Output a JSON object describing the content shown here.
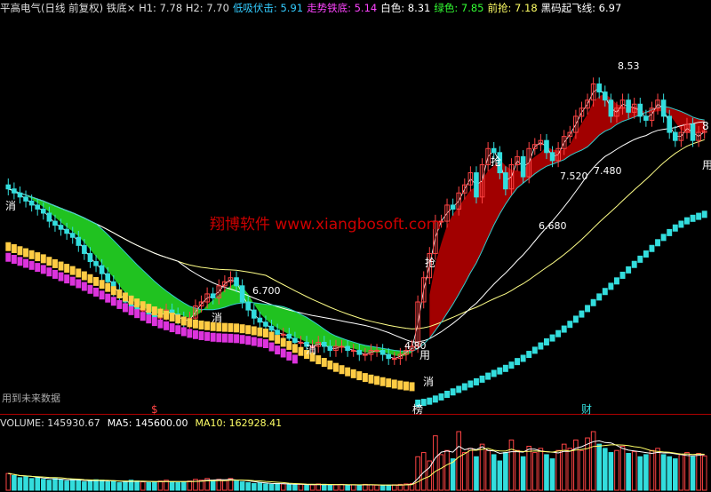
{
  "header": {
    "items": [
      {
        "text": "平高电气(日线 前复权) 铁底× H1: 7.78 H2: 7.70",
        "color": "#dddddd"
      },
      {
        "text": "低吸伏击: 5.91",
        "color": "#33ccff"
      },
      {
        "text": "走势铁底: 5.14",
        "color": "#ff44ff"
      },
      {
        "text": "白色: 8.31",
        "color": "#ffffff"
      },
      {
        "text": "绿色: 7.85",
        "color": "#33ff33"
      },
      {
        "text": "前抢: 7.18",
        "color": "#ffff66"
      },
      {
        "text": "黑码起飞线: 6.97",
        "color": "#ffffff"
      }
    ]
  },
  "watermark": "翔博软件 www.xiangbosoft.com",
  "future_note": "用到未来数据",
  "volume_header": {
    "items": [
      {
        "text": "VOLUME: 145930.67",
        "color": "#dddddd"
      },
      {
        "text": "MA5: 145600.00",
        "color": "#ffffff"
      },
      {
        "text": "MA10: 162928.41",
        "color": "#ffff66"
      }
    ]
  },
  "colors": {
    "up": "#ff4444",
    "down": "#33dddd",
    "green_band": "#22cc22",
    "red_band": "#aa0000",
    "yellow_bar": "#ffcc44",
    "magenta_bar": "#dd33dd",
    "cyan_bar": "#33dddd",
    "axis": "#b00000"
  },
  "chart_data": [
    {
      "type": "candlestick",
      "title": "平高电气(日线 前复权)",
      "annotations": [
        {
          "label": "8.53",
          "kind": "high"
        },
        {
          "label": "6.700",
          "kind": "local-high"
        },
        {
          "label": "6.680",
          "kind": "local-low"
        },
        {
          "label": "7.520",
          "kind": "level"
        },
        {
          "label": "7.480",
          "kind": "level"
        },
        {
          "label": "4.80",
          "kind": "low"
        }
      ],
      "signal_labels": [
        "消",
        "消",
        "消",
        "消",
        "抢",
        "抢",
        "用",
        "用",
        "8"
      ],
      "bottom_markers": [
        "$",
        "榜",
        "财"
      ],
      "close": [
        7.0,
        6.95,
        6.9,
        6.85,
        6.8,
        6.75,
        6.7,
        6.6,
        6.55,
        6.5,
        6.45,
        6.4,
        6.3,
        6.2,
        6.1,
        6.05,
        5.95,
        5.85,
        5.75,
        5.65,
        5.6,
        5.55,
        5.5,
        5.5,
        5.45,
        5.4,
        5.45,
        5.5,
        5.45,
        5.4,
        5.35,
        5.4,
        5.55,
        5.6,
        5.7,
        5.65,
        5.8,
        5.85,
        5.9,
        5.8,
        5.6,
        5.5,
        5.4,
        5.35,
        5.3,
        5.25,
        5.2,
        5.2,
        5.15,
        5.1,
        5.1,
        5.05,
        5.05,
        5.1,
        5.05,
        5.0,
        5.05,
        5.05,
        5.0,
        5.0,
        4.95,
        4.95,
        5.0,
        5.0,
        4.95,
        4.9,
        4.9,
        4.95,
        5.0,
        5.05,
        5.6,
        5.9,
        6.2,
        6.6,
        6.6,
        6.8,
        6.75,
        6.95,
        7.05,
        7.2,
        6.9,
        7.3,
        7.5,
        7.45,
        7.2,
        7.0,
        7.3,
        7.4,
        7.15,
        7.5,
        7.55,
        7.6,
        7.45,
        7.35,
        7.5,
        7.65,
        7.7,
        7.9,
        8.0,
        8.1,
        8.3,
        8.2,
        8.1,
        7.9,
        8.0,
        8.1,
        7.95,
        8.05,
        7.9,
        7.85,
        8.0,
        8.1,
        7.9,
        7.7,
        7.6,
        7.7,
        7.8,
        7.6,
        7.7,
        7.72
      ],
      "volume": [
        40,
        35,
        30,
        32,
        28,
        30,
        26,
        24,
        28,
        25,
        22,
        26,
        24,
        20,
        22,
        25,
        24,
        20,
        22,
        18,
        20,
        24,
        22,
        20,
        18,
        20,
        22,
        24,
        20,
        18,
        20,
        22,
        26,
        24,
        28,
        22,
        26,
        24,
        28,
        22,
        20,
        18,
        16,
        18,
        15,
        14,
        16,
        15,
        14,
        13,
        14,
        12,
        13,
        15,
        14,
        12,
        13,
        14,
        12,
        13,
        12,
        14,
        13,
        12,
        11,
        12,
        13,
        14,
        15,
        16,
        80,
        90,
        70,
        130,
        85,
        95,
        75,
        140,
        90,
        100,
        80,
        110,
        95,
        85,
        70,
        90,
        120,
        95,
        80,
        105,
        90,
        100,
        85,
        75,
        95,
        110,
        100,
        120,
        95,
        125,
        140,
        110,
        100,
        90,
        95,
        105,
        88,
        92,
        80,
        85,
        95,
        100,
        85,
        80,
        75,
        85,
        90,
        80,
        88,
        82
      ]
    }
  ]
}
